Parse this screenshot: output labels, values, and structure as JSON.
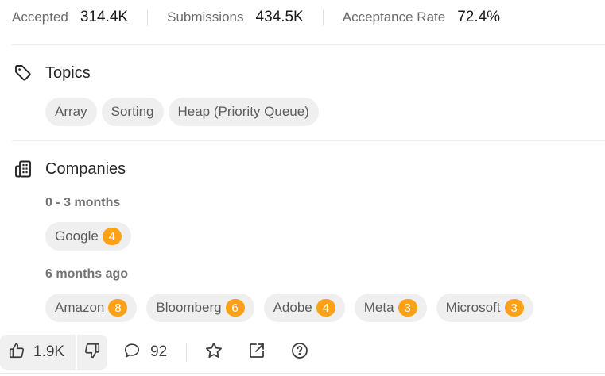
{
  "stats": {
    "accepted_label": "Accepted",
    "accepted_value": "314.4K",
    "submissions_label": "Submissions",
    "submissions_value": "434.5K",
    "rate_label": "Acceptance Rate",
    "rate_value": "72.4%"
  },
  "topics": {
    "title": "Topics",
    "icon": "tag-icon",
    "items": [
      "Array",
      "Sorting",
      "Heap (Priority Queue)"
    ]
  },
  "companies": {
    "title": "Companies",
    "icon": "building-icon",
    "groups": [
      {
        "period": "0 - 3 months",
        "items": [
          {
            "name": "Google",
            "count": "4"
          }
        ]
      },
      {
        "period": "6 months ago",
        "items": [
          {
            "name": "Amazon",
            "count": "8"
          },
          {
            "name": "Bloomberg",
            "count": "6"
          },
          {
            "name": "Adobe",
            "count": "4"
          },
          {
            "name": "Meta",
            "count": "3"
          },
          {
            "name": "Microsoft",
            "count": "3"
          }
        ]
      }
    ]
  },
  "footer": {
    "likes": "1.9K",
    "comments": "92"
  },
  "colors": {
    "badge": "#ffa116",
    "chip_bg": "#efefef",
    "text": "#262626"
  }
}
